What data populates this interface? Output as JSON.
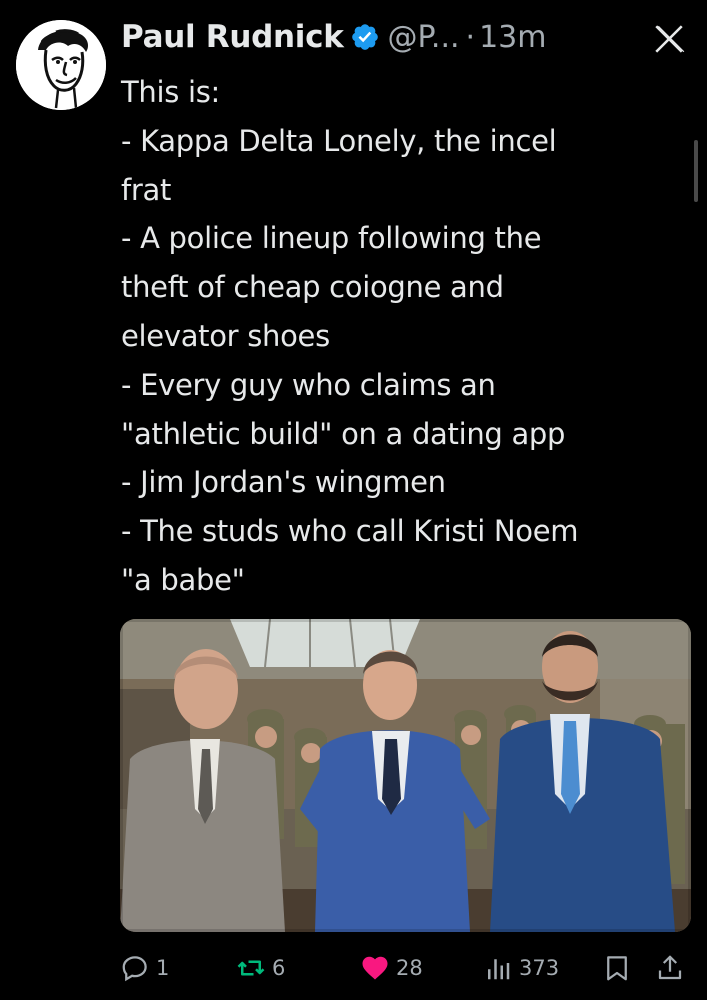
{
  "tweet": {
    "author_name": "Paul Rudnick",
    "handle": "@P...",
    "separator": "·",
    "time": "13m",
    "verified": true,
    "text_lines": [
      "This is:",
      "- Kappa Delta Lonely, the incel",
      "frat",
      "- A police lineup following the",
      "theft of cheap coiogne and",
      "elevator shoes",
      "- Every guy who claims an",
      "\"athletic build\" on a dating app",
      "- Jim Jordan's wingmen",
      "- The studs who call Kristi Noem",
      "\"a babe\""
    ]
  },
  "actions": {
    "reply_count": "1",
    "retweet_count": "6",
    "like_count": "28",
    "view_count": "373"
  },
  "icons": {
    "close": "x-close-icon",
    "verified": "verified-badge-icon",
    "reply": "reply-icon",
    "retweet": "retweet-icon",
    "like": "heart-icon",
    "views": "views-icon",
    "bookmark": "bookmark-icon",
    "share": "share-icon"
  },
  "colors": {
    "background": "#000000",
    "text": "#e7e9ea",
    "secondary_text": "#a5acb2",
    "verified_blue": "#1d9bf0",
    "retweet_green": "#00ba7c",
    "like_pink": "#f91880"
  }
}
